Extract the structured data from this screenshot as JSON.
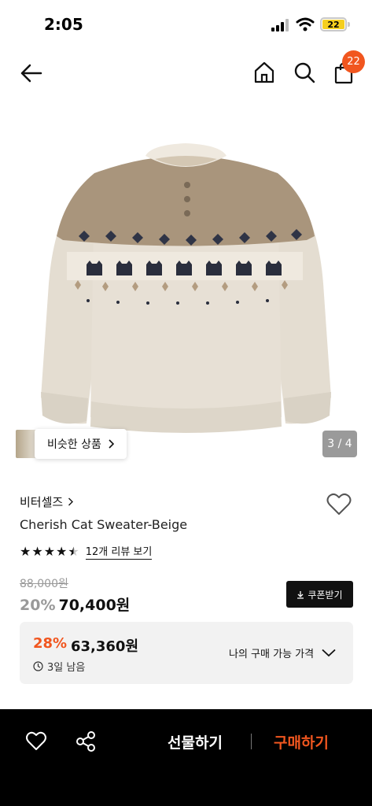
{
  "status_bar": {
    "time": "2:05",
    "battery": "22"
  },
  "nav": {
    "cart_count": "22"
  },
  "gallery": {
    "similar_label": "비슷한 상품",
    "counter": "3 / 4"
  },
  "product": {
    "brand": "비터셀즈",
    "name": "Cherish Cat Sweater-Beige",
    "rating": 4.5,
    "review_link": "12개 리뷰 보기",
    "original_price": "88,000원",
    "discount": "20%",
    "price": "70,400원",
    "coupon_label": "쿠폰받기"
  },
  "best_price": {
    "discount": "28%",
    "price": "63,360원",
    "days_left": "3일 남음",
    "toggle_label": "나의 구매 가능 가격"
  },
  "bottom_bar": {
    "gift_label": "선물하기",
    "buy_label": "구매하기"
  },
  "colors": {
    "accent": "#f1561f",
    "dark": "#111111",
    "box_bg": "#f2f2f2",
    "battery": "#f5cf1f"
  },
  "icons": [
    "back-arrow-icon",
    "home-icon",
    "search-icon",
    "shopping-bag-icon",
    "heart-icon",
    "share-icon",
    "chevron-right-icon",
    "chevron-down-icon",
    "download-icon",
    "clock-icon",
    "star-icon"
  ]
}
